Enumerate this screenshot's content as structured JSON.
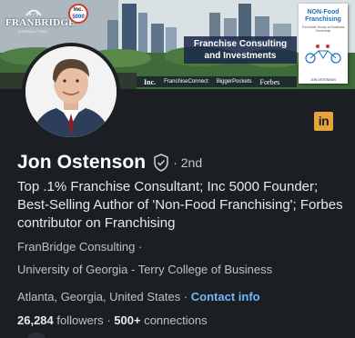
{
  "banner": {
    "brand_name": "FRANBRIDGE",
    "brand_sub": "CONSULTING",
    "inc_badge_top": "Inc.",
    "inc_badge_number": "5000",
    "tagline_line1": "Franchise Consulting",
    "tagline_line2": "and Investments",
    "book_title_line1": "NON-Food",
    "book_title_line2": "Franchising",
    "book_subtitle": "The Inside Scoop on Business Ownership",
    "book_author": "JON OSTENSON",
    "media": [
      "Inc.",
      "FranchiseConnect",
      "BiggerPockets",
      "Forbes"
    ]
  },
  "profile": {
    "name": "Jon Ostenson",
    "degree": "· 2nd",
    "headline": "Top .1% Franchise Consultant; Inc 5000 Founder; Best-Selling Author of 'Non-Food Franchising'; Forbes contributor on Franchising",
    "company": "FranBridge Consulting ·",
    "school": "University of Georgia - Terry College of Business",
    "location": "Atlanta, Georgia, United States ·",
    "contact_label": "Contact info",
    "followers_count": "26,284",
    "followers_label": "followers",
    "connections_count": "500+",
    "connections_label": "connections",
    "stats_separator": "·"
  },
  "linkedin_button": {
    "label": "in"
  },
  "colors": {
    "background": "#1b1f23",
    "link": "#71b7fb",
    "linkedin_badge": "#e8a23a"
  },
  "icons": [
    "verified-shield-icon",
    "linkedin-icon"
  ]
}
